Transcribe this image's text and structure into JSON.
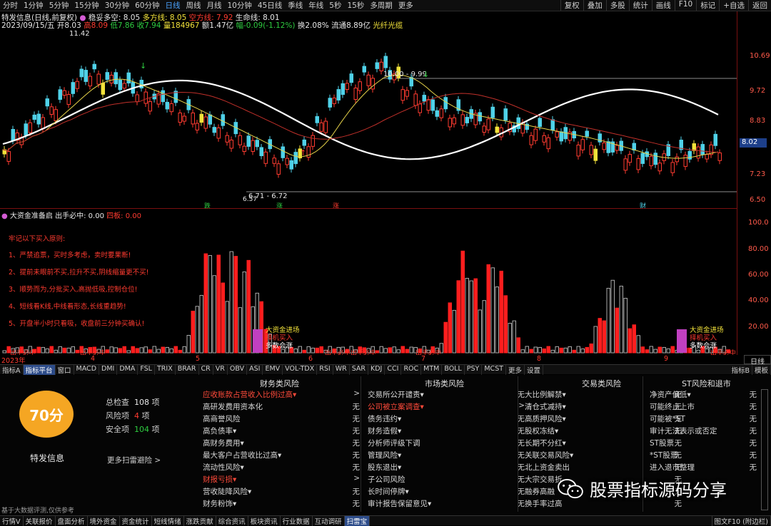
{
  "toolbar": {
    "timeframes": [
      "分时",
      "1分钟",
      "5分钟",
      "15分钟",
      "30分钟",
      "60分钟",
      "日线",
      "周线",
      "月线",
      "10分钟",
      "45日线",
      "季线",
      "年线",
      "5秒",
      "15秒",
      "多周期",
      "更多"
    ],
    "active": "日线",
    "right": [
      "复权",
      "叠加",
      "多股",
      "统计",
      "画线",
      "F10",
      "标记",
      "+自选",
      "返回"
    ]
  },
  "info": {
    "stock": "特发信息(日线,前复权)",
    "signal1_label": "稳妥多空:",
    "signal1_val": "8.05",
    "signal2_label": "多方线:",
    "signal2_val": "8.05",
    "signal3_label": "空方线:",
    "signal3_val": "7.92",
    "signal4_label": "生命线:",
    "signal4_val": "8.01",
    "date": "2023/09/15/五",
    "open": "开8.03",
    "high": "高8.09",
    "low": "低7.86",
    "close": "收7.94",
    "vol": "量184967",
    "amt": "额1.47亿",
    "chg": "幅-0.09(-1.12%)",
    "turnover": "换2.08%",
    "float": "流通8.89亿",
    "concept": "光纤光缆"
  },
  "price_axis": [
    "10.69",
    "9.72",
    "8.83",
    "8.02",
    "7.23",
    "6.50"
  ],
  "price_tag": "8.02",
  "annotations": {
    "high": "11.42",
    "range1": "10.00 - 9.99",
    "range2": "6.71 - 6.72",
    "low": "6.57",
    "markers": [
      "跌",
      "涨",
      "涨",
      "财"
    ]
  },
  "indicator": {
    "title": "大资金准备启",
    "out_label": "出手必中:",
    "out_val": "0.00",
    "flag": "四板:",
    "flag_val": "0.00",
    "rules": [
      "牢记以下买入原则:",
      "1、严禁追票，买时多考虑，卖时要果断!",
      "2、提前未眼前不买,拉升不买,阴线缩量更不买!",
      "3、顺势而为,分批买入,高抛低吸,控制仓位!",
      "4、短线看K线,中线看形态,长线重趋势!",
      "5、开盘半小时只看吸，收盘前三分钟买确认!"
    ],
    "legend": [
      "大资金进场",
      "择机买入",
      "多数会涨"
    ],
    "axis": [
      "100.0",
      "80.00",
      "60.00",
      "40.00",
      "20.00"
    ],
    "bottom_labels": [
      "出手必中",
      "出手必中",
      "出手必中出手必中",
      "出手必中",
      "出手必中"
    ],
    "months": [
      "2023年",
      "4",
      "5",
      "6",
      "7",
      "8",
      "9"
    ],
    "period": "日线"
  },
  "tabs": {
    "items": [
      "指标A",
      "指标平台",
      "窗口",
      "MACD",
      "DMI",
      "DMA",
      "FSL",
      "TRIX",
      "BRAR",
      "CR",
      "VR",
      "OBV",
      "ASI",
      "EMV",
      "VOL-TDX",
      "RSI",
      "WR",
      "SAR",
      "KDJ",
      "CCI",
      "ROC",
      "MTM",
      "BOLL",
      "PSY",
      "MCST",
      "更多",
      "设置"
    ],
    "active": "指标平台",
    "right": [
      "指标B",
      "模板"
    ]
  },
  "risk": {
    "score": "70分",
    "company": "特发信息",
    "total_label": "总检查",
    "total_val": "108",
    "unit": "项",
    "risk_label": "风险项",
    "risk_val": "4",
    "safe_label": "安全项",
    "safe_val": "104",
    "more": "更多扫雷避险 >",
    "disclaimer": "基于大数据评测,仅供参考",
    "columns": [
      {
        "title": "财务类风险",
        "rows": [
          [
            "应收账款占营收入比例过高▾",
            ">",
            true
          ],
          [
            "高研发费用资本化",
            "无",
            false
          ],
          [
            "高商誉风险",
            "无",
            false
          ],
          [
            "高负债率▾",
            "无",
            false
          ],
          [
            "高财务费用▾",
            "无",
            false
          ],
          [
            "最大客户占营收比过高▾",
            "无",
            false
          ],
          [
            "流动性风险▾",
            "无",
            false
          ],
          [
            "财报亏损▾",
            ">",
            true
          ],
          [
            "营收陡降风险▾",
            "无",
            false
          ],
          [
            "财务粉饰▾",
            "无",
            false
          ]
        ]
      },
      {
        "title": "市场类风险",
        "rows": [
          [
            "交易所公开谴责▾",
            "无",
            false
          ],
          [
            "公司被立案调查▾",
            ">",
            true
          ],
          [
            "债务违约▾",
            "无",
            false
          ],
          [
            "财务造假▾",
            "无",
            false
          ],
          [
            "分析师评级下调",
            "无",
            false
          ],
          [
            "管理风险▾",
            "无",
            false
          ],
          [
            "股东退出▾",
            "无",
            false
          ],
          [
            "子公司风险",
            "无",
            false
          ],
          [
            "长时间停牌▾",
            "无",
            false
          ],
          [
            "审计报告保留意见▾",
            "无",
            false
          ]
        ]
      },
      {
        "title": "交易类风险",
        "rows": [
          [
            "大比例解禁▾",
            "无",
            false
          ],
          [
            "清仓式减持▾",
            "无",
            false
          ],
          [
            "高质押风险▾",
            "无",
            false
          ],
          [
            "股权冻结▾",
            "无",
            false
          ],
          [
            "长期不分红▾",
            "无",
            false
          ],
          [
            "关联交易风险▾",
            "无",
            false
          ],
          [
            "北上资金卖出",
            "无",
            false
          ],
          [
            "大宗交易折",
            "无",
            false
          ],
          [
            "融券高融",
            "无",
            false
          ],
          [
            "换手率过高",
            "无",
            false
          ]
        ]
      },
      {
        "title": "ST风险和退市",
        "rows": [
          [
            "净资产偏低▾",
            "无",
            false
          ],
          [
            "可能终止上市",
            "无",
            false
          ],
          [
            "可能被*ST",
            "无",
            false
          ],
          [
            "审计无法表示或否定",
            "无",
            false
          ],
          [
            "ST股票",
            "无",
            false
          ],
          [
            "*ST股票",
            "无",
            false
          ],
          [
            "进入退市整理",
            "无",
            false
          ]
        ]
      }
    ]
  },
  "watermark": "股票指标源码分享",
  "footer": {
    "items": [
      "行情V",
      "关联报价",
      "盘面分析",
      "境外资金",
      "资金统计",
      "短线情绪",
      "涨跌贡献",
      "综合资讯",
      "板块资讯",
      "行业数据",
      "互动调研",
      "扫雷宝"
    ],
    "active": "扫雷宝",
    "right": "图文F10 (附边栏)"
  }
}
